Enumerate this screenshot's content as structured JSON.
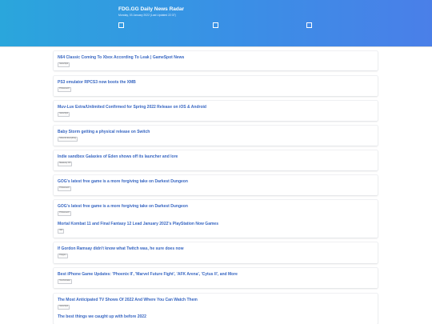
{
  "header": {
    "title": "FDG.GG Daily News Radar",
    "subtitle": "Monday, 03 January 2022 (Last Updated 22:37)"
  },
  "items": [
    {
      "title": "N64 Classic Coming To Xbox According To Leak | GameSpot News",
      "source": "GameSpot"
    },
    {
      "title": "PS3 emulator RPCS3 now boots the XMB",
      "source": "PCGamesN"
    },
    {
      "title": "Muv-Luv Extra/Unlimited Confirmed for Spring 2022 Release on iOS & Android",
      "source": "GameSpot"
    },
    {
      "title": "Baby Storm getting a physical release on Switch",
      "source": "Nintendo Everything"
    },
    {
      "title": "Indie sandbox Galaxies of Eden shows off its launcher and lore",
      "source": "Massively OP"
    },
    {
      "title": "GOG's latest free game is a more forgiving take on Darkest Dungeon",
      "source": "PCGamesN"
    },
    {
      "title": "GOG's latest free game is a more forgiving take on Darkest Dungeon",
      "source": "PCGamesN"
    },
    {
      "title": "Mortal Kombat 11 and Final Fantasy 12 Lead January 2022's PlayStation Now Games",
      "source": "IGN"
    },
    {
      "title": "If Gordon Ramsay didn't know what Twitch was, he sure does now",
      "source": "Polygon"
    },
    {
      "title": "Best iPhone Game Updates: 'Phoenix II', 'Marvel Future Fight', 'AFK Arena', 'Cytus II', and More",
      "source": "TouchArcade"
    },
    {
      "title": "The Most Anticipated TV Shows Of 2022 And Where You Can Watch Them",
      "source": "GameSpot"
    },
    {
      "title": "The best things we caught up with before 2022",
      "source": ""
    }
  ]
}
